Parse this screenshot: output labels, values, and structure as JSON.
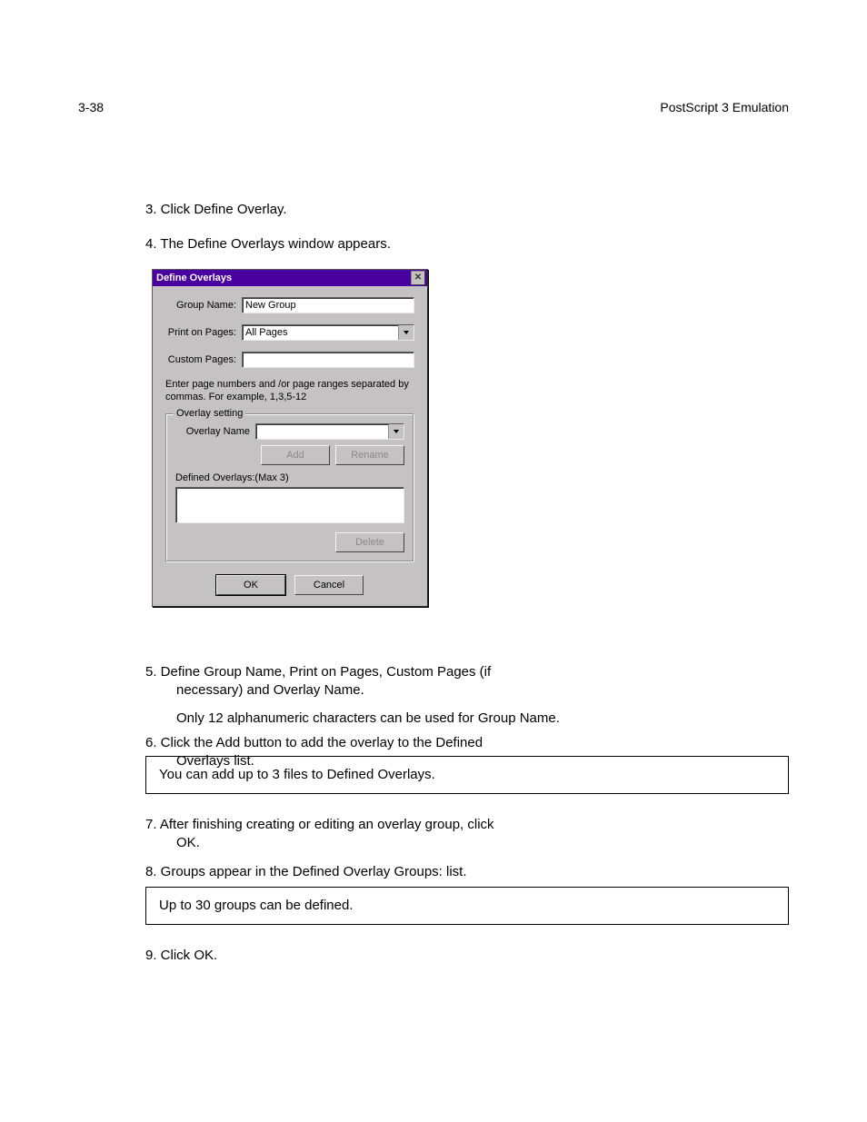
{
  "page": {
    "number": "3-38",
    "running_header": "PostScript 3 Emulation"
  },
  "intro": {
    "step3": "3.  Click Define Overlay.",
    "step4": "4.  The Define Overlays window appears."
  },
  "dialog": {
    "title": "Define Overlays",
    "close_icon": "close-icon",
    "labels": {
      "group_name": "Group Name:",
      "print_on_pages": "Print on Pages:",
      "custom_pages": "Custom Pages:"
    },
    "values": {
      "group_name": "New Group",
      "print_on_pages": "All Pages",
      "custom_pages": ""
    },
    "hint": "Enter page numbers and /or page ranges separated by commas. For example, 1,3,5-12",
    "overlay_setting": {
      "legend": "Overlay setting",
      "overlay_name_label": "Overlay Name",
      "overlay_name_value": "",
      "add": "Add",
      "rename": "Rename",
      "defined_label": "Defined Overlays:(Max 3)",
      "delete": "Delete"
    },
    "actions": {
      "ok": "OK",
      "cancel": "Cancel"
    }
  },
  "doc": {
    "step5_a": "5.  Define Group Name, Print on Pages, Custom Pages (if",
    "step5_b": "necessary) and Overlay Name.",
    "step5_c": "Only 12 alphanumeric characters can be used for Group Name.",
    "step6_a": "6.  Click the Add button to add the overlay to the Defined",
    "step6_b": "Overlays list.",
    "note1": "You can add up to 3 files to Defined Overlays.",
    "step7_a": "7.  After finishing creating or editing an overlay group, click",
    "step7_b": "OK.",
    "step8": "8.  Groups appear in the Defined Overlay Groups: list.",
    "note2": "Up to 30 groups can be defined.",
    "step9": "9.  Click OK."
  },
  "footer": {
    "left": "",
    "right": ""
  }
}
